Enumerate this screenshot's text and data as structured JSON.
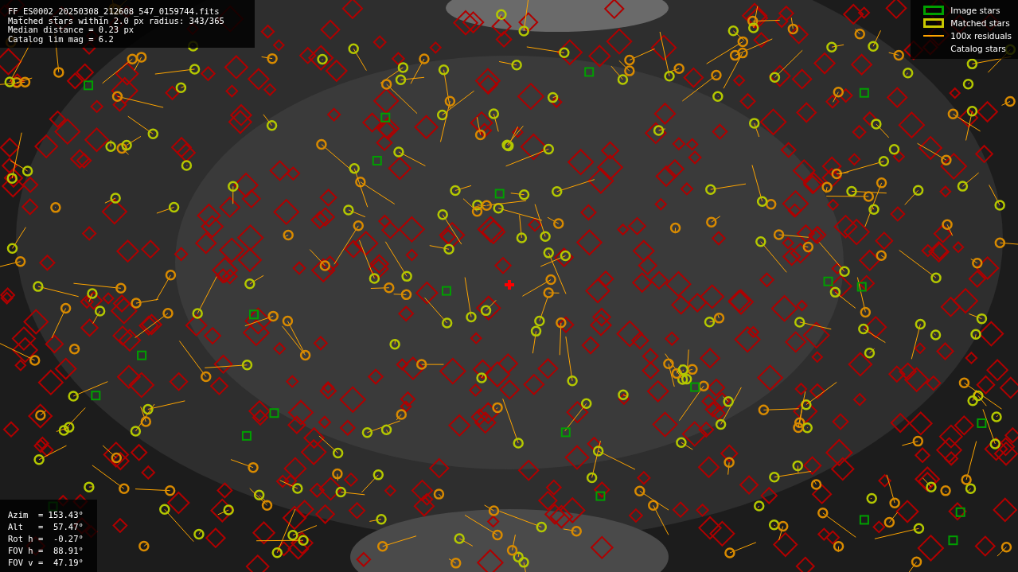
{
  "info": {
    "lines": [
      "FF_ES0002_20250308_212608_547_0159744.fits",
      "Matched stars within 2.0 px radius: 343/365",
      "Median distance = 0.23 px",
      "Catalog lim mag = 6.2"
    ]
  },
  "legend": [
    {
      "label": "Image stars",
      "kind": "box",
      "color": "#00a000"
    },
    {
      "label": "Matched stars",
      "kind": "box",
      "color": "#c8c800"
    },
    {
      "label": "100x residuals",
      "kind": "line",
      "color": "#ffa500"
    },
    {
      "label": "Catalog stars",
      "kind": "none"
    }
  ],
  "pointing": {
    "lines": [
      "Azim  = 153.43°",
      "Alt   =  57.47°",
      "Rot h =  -0.27°",
      "FOV h =  88.91°",
      "FOV v =  47.19°"
    ]
  }
}
